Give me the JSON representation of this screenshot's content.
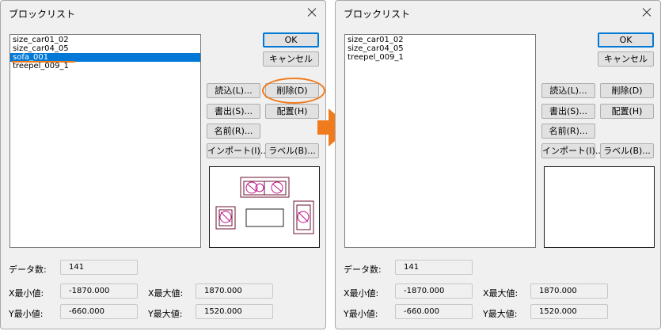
{
  "before": {
    "title": "ブロックリスト",
    "list_items": [
      "size_car01_02",
      "size_car04_05",
      "sofa_001",
      "treepel_009_1"
    ],
    "selected_item": "sofa_001",
    "buttons": {
      "ok": "OK",
      "cancel": "キャンセル",
      "load": "読込(L)...",
      "delete": "削除(D)",
      "export": "書出(S)...",
      "place": "配置(H)",
      "name": "名前(R)...",
      "import": "インポート(I)...",
      "label": "ラベル(B)..."
    },
    "fields": {
      "count_label": "データ数:",
      "count_value": "141",
      "xmin_label": "X最小値:",
      "xmin_value": "-1870.000",
      "xmax_label": "X最大値:",
      "xmax_value": "1870.000",
      "ymin_label": "Y最小値:",
      "ymin_value": "-660.000",
      "ymax_label": "Y最大値:",
      "ymax_value": "1520.000"
    }
  },
  "after": {
    "title": "ブロックリスト",
    "list_items": [
      "size_car01_02",
      "size_car04_05",
      "treepel_009_1"
    ],
    "buttons": {
      "ok": "OK",
      "cancel": "キャンセル",
      "load": "読込(L)...",
      "delete": "削除(D)",
      "export": "書出(S)...",
      "place": "配置(H)",
      "name": "名前(R)...",
      "import": "インポート(I)...",
      "label": "ラベル(B)..."
    },
    "fields": {
      "count_label": "データ数:",
      "count_value": "141",
      "xmin_label": "X最小値:",
      "xmin_value": "-1870.000",
      "xmax_label": "X最大値:",
      "xmax_value": "1870.000",
      "ymin_label": "Y最小値:",
      "ymin_value": "-660.000",
      "ymax_label": "Y最大値:",
      "ymax_value": "1520.000"
    }
  },
  "colors": {
    "accent_orange": "#f07b1d",
    "selection_blue": "#0078d7",
    "preview_stroke": "#6b1030",
    "preview_magenta": "#c0158c"
  },
  "icons": [
    "close-icon",
    "right-arrow-icon"
  ]
}
